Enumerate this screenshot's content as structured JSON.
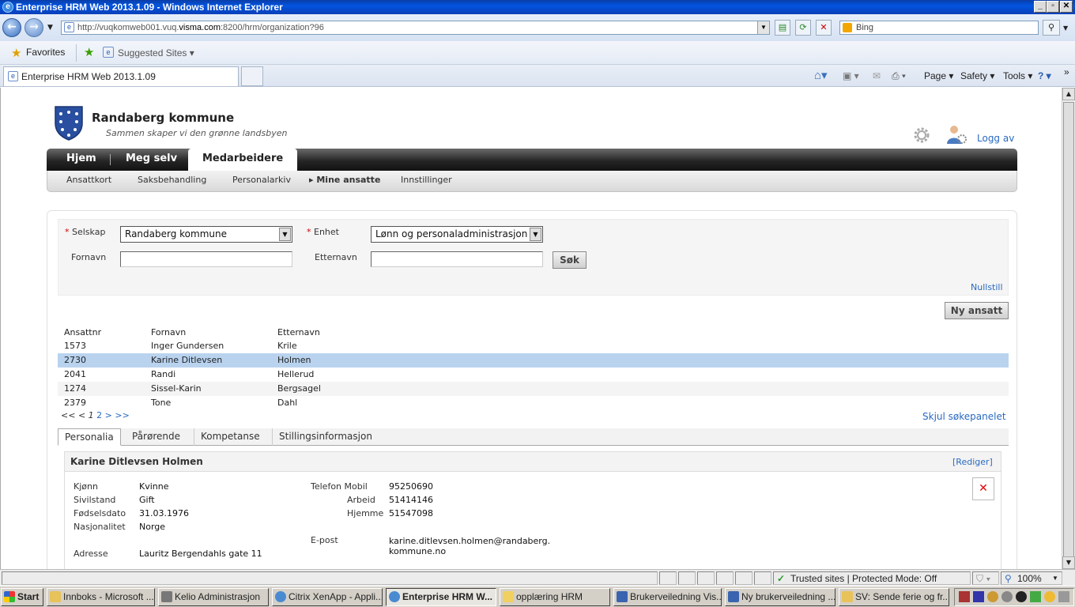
{
  "window": {
    "title": "Enterprise HRM Web 2013.1.09 - Windows Internet Explorer"
  },
  "browser": {
    "url_prefix": "http://vuqkomweb001.vuq.",
    "url_domain": "visma.com",
    "url_suffix": ":8200/hrm/organization?96",
    "search_placeholder": "Bing",
    "favorites_label": "Favorites",
    "suggested_sites_label": "Suggested Sites",
    "tab_title": "Enterprise HRM Web 2013.1.09",
    "commands": {
      "page": "Page",
      "safety": "Safety",
      "tools": "Tools"
    }
  },
  "header": {
    "org_name": "Randaberg kommune",
    "org_slogan": "Sammen skaper vi den grønne landsbyen",
    "logout_label": "Logg av"
  },
  "mainnav": {
    "items": [
      {
        "label": "Hjem"
      },
      {
        "label": "Meg selv"
      },
      {
        "label": "Medarbeidere"
      }
    ]
  },
  "subnav": {
    "items": [
      {
        "label": "Ansattkort"
      },
      {
        "label": "Saksbehandling"
      },
      {
        "label": "Personalarkiv"
      },
      {
        "label": "Mine ansatte"
      },
      {
        "label": "Innstillinger"
      }
    ]
  },
  "search": {
    "selskap_label": "Selskap",
    "selskap_value": "Randaberg kommune",
    "enhet_label": "Enhet",
    "enhet_value": "Lønn og personaladministrasjon",
    "fornavn_label": "Fornavn",
    "fornavn_value": "",
    "etternavn_label": "Etternavn",
    "etternavn_value": "",
    "search_button": "Søk",
    "reset_link": "Nullstill",
    "required_marker": "*"
  },
  "new_employee_button": "Ny ansatt",
  "table": {
    "headers": [
      "Ansattnr",
      "Fornavn",
      "Etternavn"
    ],
    "rows": [
      [
        "1573",
        "Inger Gundersen",
        "Krile"
      ],
      [
        "2730",
        "Karine Ditlevsen",
        "Holmen"
      ],
      [
        "2041",
        "Randi",
        "Hellerud"
      ],
      [
        "1274",
        "Sissel-Karin",
        "Bergsagel"
      ],
      [
        "2379",
        "Tone",
        "Dahl"
      ]
    ],
    "selected_row": 1
  },
  "pager": {
    "first": "<<",
    "prev": "<",
    "page1": "1",
    "page2": "2",
    "next": ">",
    "last": ">>"
  },
  "hide_search_link": "Skjul søkepanelet",
  "detail_tabs": [
    {
      "label": "Personalia"
    },
    {
      "label": "Pårørende"
    },
    {
      "label": "Kompetanse"
    },
    {
      "label": "Stillingsinformasjon"
    }
  ],
  "person": {
    "name": "Karine Ditlevsen Holmen",
    "edit_link": "[Rediger]",
    "labels": {
      "gender": "Kjønn",
      "civil": "Sivilstand",
      "birth": "Fødselsdato",
      "nationality": "Nasjonalitet",
      "address": "Adresse",
      "phone_mobile": "Telefon Mobil",
      "phone_work": "Arbeid",
      "phone_home": "Hjemme",
      "email": "E-post"
    },
    "gender": "Kvinne",
    "civil": "Gift",
    "birth": "31.03.1976",
    "nationality": "Norge",
    "address": "Lauritz Bergendahls gate 11",
    "phone_mobile": "95250690",
    "phone_work": "51414146",
    "phone_home": "51547098",
    "email_line1": "karine.ditlevsen.holmen@randaberg.",
    "email_line2": "kommune.no"
  },
  "statusbar": {
    "zone": "Trusted sites | Protected Mode: Off",
    "zoom": "100%"
  },
  "taskbar": {
    "start": "Start",
    "items": [
      {
        "label": "Innboks - Microsoft ..."
      },
      {
        "label": "Kelio Administrasjon"
      },
      {
        "label": "Citrix XenApp - Appli..."
      },
      {
        "label": "Enterprise HRM W..."
      },
      {
        "label": "opplæring HRM"
      },
      {
        "label": "Brukerveiledning Vis..."
      },
      {
        "label": "Ny brukerveiledning ..."
      },
      {
        "label": "SV: Sende ferie og fr..."
      }
    ]
  },
  "colors": {
    "accent_link": "#2a6ac0",
    "selected_row": "#b9d3ef",
    "nav_dark": "#262626",
    "titlebar": "#0254e0"
  }
}
